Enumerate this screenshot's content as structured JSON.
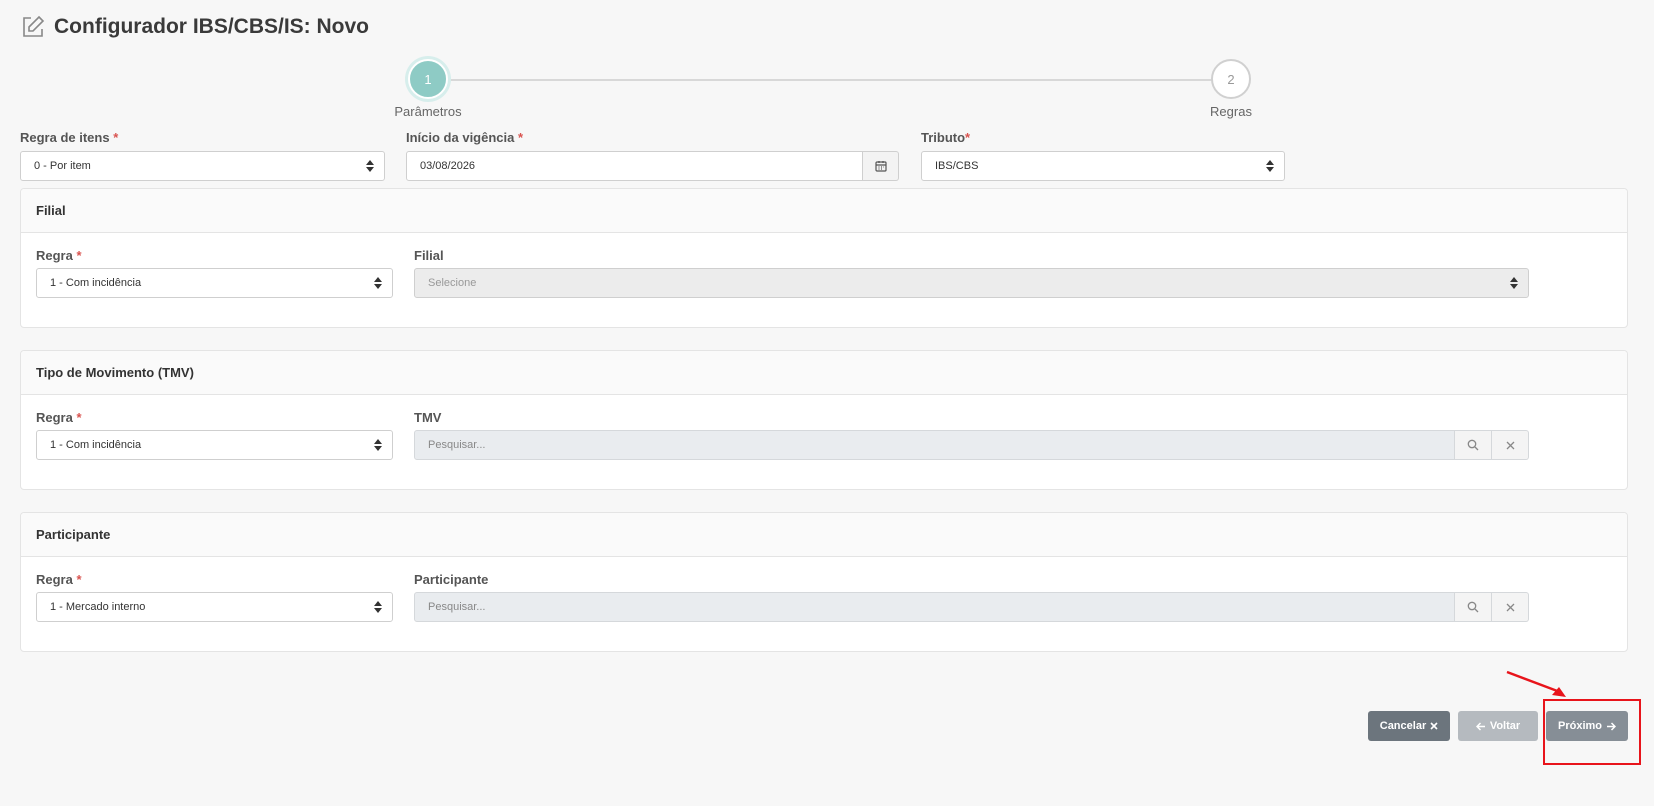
{
  "header": {
    "title": "Configurador IBS/CBS/IS: Novo",
    "icon": "edit-icon"
  },
  "stepper": {
    "steps": [
      {
        "number": "1",
        "label": "Parâmetros",
        "active": true
      },
      {
        "number": "2",
        "label": "Regras",
        "active": false
      }
    ]
  },
  "form": {
    "regra_itens": {
      "label": "Regra de itens ",
      "required": "*",
      "value": "0 - Por item"
    },
    "inicio_vigencia": {
      "label": "Início da vigência ",
      "required": "*",
      "value": "03/08/2026"
    },
    "tributo": {
      "label": "Tributo",
      "required": "*",
      "value": "IBS/CBS"
    }
  },
  "panels": {
    "filial": {
      "title": "Filial",
      "regra_label": "Regra ",
      "regra_required": "*",
      "regra_value": "1 - Com incidência",
      "field_label": "Filial",
      "field_placeholder": "Selecione"
    },
    "tmv": {
      "title": "Tipo de Movimento (TMV)",
      "regra_label": "Regra ",
      "regra_required": "*",
      "regra_value": "1 - Com incidência",
      "field_label": "TMV",
      "field_placeholder": "Pesquisar..."
    },
    "participante": {
      "title": "Participante",
      "regra_label": "Regra ",
      "regra_required": "*",
      "regra_value": "1 - Mercado interno",
      "field_label": "Participante",
      "field_placeholder": "Pesquisar..."
    }
  },
  "buttons": {
    "cancel": "Cancelar",
    "back": "Voltar",
    "next": "Próximo"
  },
  "colors": {
    "step_active": "#8ecbc5",
    "required": "#d9534f",
    "annotation": "#e8141b"
  }
}
